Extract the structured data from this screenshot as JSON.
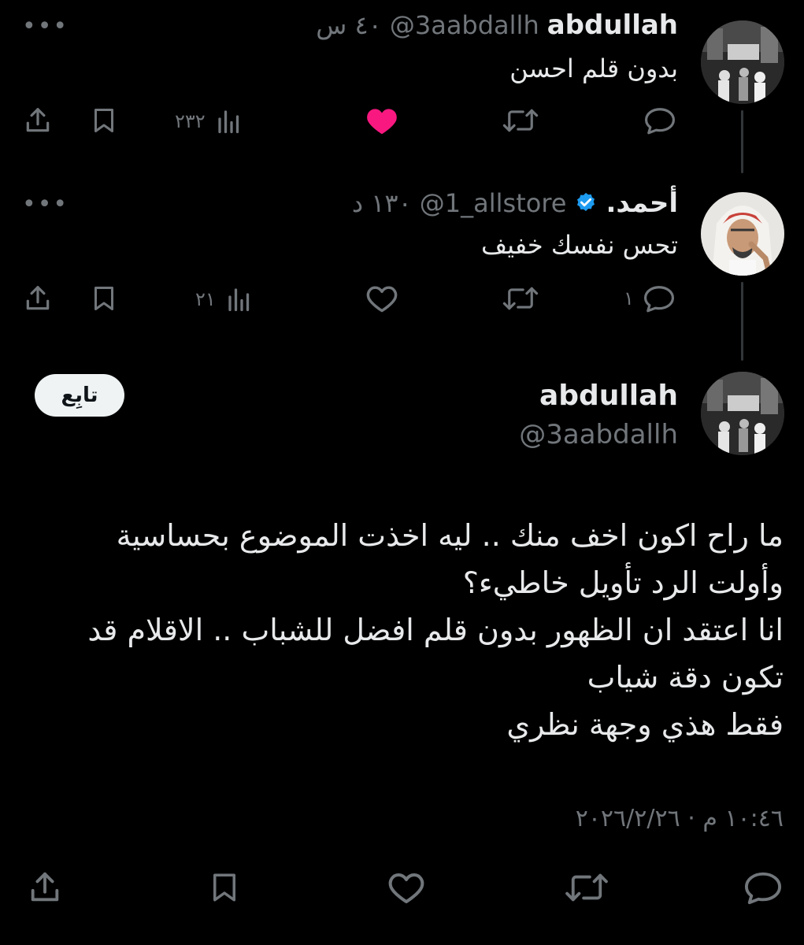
{
  "tweets": [
    {
      "display_name": "abdullah",
      "handle": "@3aabdallh",
      "time": "٤٠ س",
      "text": "بدون قلم احسن",
      "views": "٢٣٢",
      "liked": true,
      "like_color": "#f91880"
    },
    {
      "display_name": "أحمد.",
      "handle": "@1_allstore",
      "time": "١٣٠ د",
      "text": "تحس نفسك خفيف",
      "views": "٢١",
      "replies": "١",
      "verified": true,
      "verified_color": "#1d9bf0"
    }
  ],
  "main": {
    "display_name": "abdullah",
    "handle": "@3aabdallh",
    "follow_label": "تابِع",
    "text_lines": [
      "ما راح اكون اخف منك .. ليه اخذت الموضوع بحساسية",
      "وأولت الرد تأويل خاطيء؟",
      "انا اعتقد ان الظهور بدون قلم افضل للشباب .. الاقلام قد",
      "تكون دقة شياب",
      "فقط هذي وجهة نظري"
    ],
    "timestamp": "١٠:٤٦ م · ٢٠٢٦/٢/٢٦"
  },
  "more_label": "•••",
  "icons": [
    "share-icon",
    "bookmark-icon",
    "views-icon",
    "like-icon",
    "retweet-icon",
    "reply-icon",
    "verified-icon",
    "more-icon"
  ]
}
